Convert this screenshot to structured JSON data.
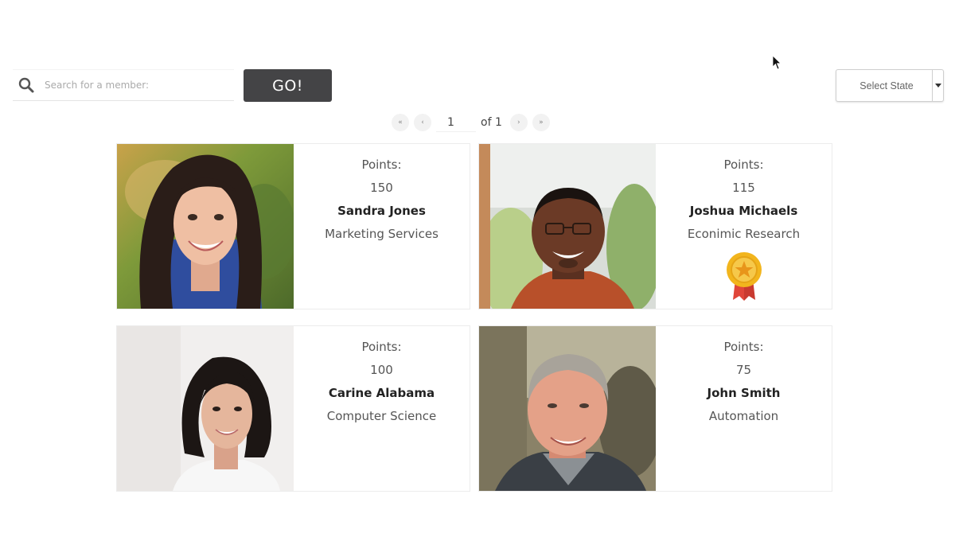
{
  "toolbar": {
    "search_placeholder": "Search for a member:",
    "go_label": "GO!",
    "state_select_label": "Select State"
  },
  "pagination": {
    "current_page": "1",
    "of_label": "of 1",
    "first_label": "«",
    "prev_label": "‹",
    "next_label": "›",
    "last_label": "»"
  },
  "members": [
    {
      "points_label": "Points:",
      "points": "150",
      "name": "Sandra Jones",
      "department": "Marketing Services",
      "has_award": false
    },
    {
      "points_label": "Points:",
      "points": "115",
      "name": "Joshua Michaels",
      "department": "Econimic Research",
      "has_award": true
    },
    {
      "points_label": "Points:",
      "points": "100",
      "name": "Carine Alabama",
      "department": "Computer Science",
      "has_award": false
    },
    {
      "points_label": "Points:",
      "points": "75",
      "name": "John Smith",
      "department": "Automation",
      "has_award": false
    }
  ],
  "icons": {
    "search": "search-icon",
    "dropdown": "chevron-down-icon",
    "award": "award-ribbon-icon",
    "cursor": "mouse-pointer-icon"
  },
  "colors": {
    "go_button_bg": "#444446",
    "award_gold": "#f2b51d",
    "award_ribbon": "#e0463a"
  }
}
